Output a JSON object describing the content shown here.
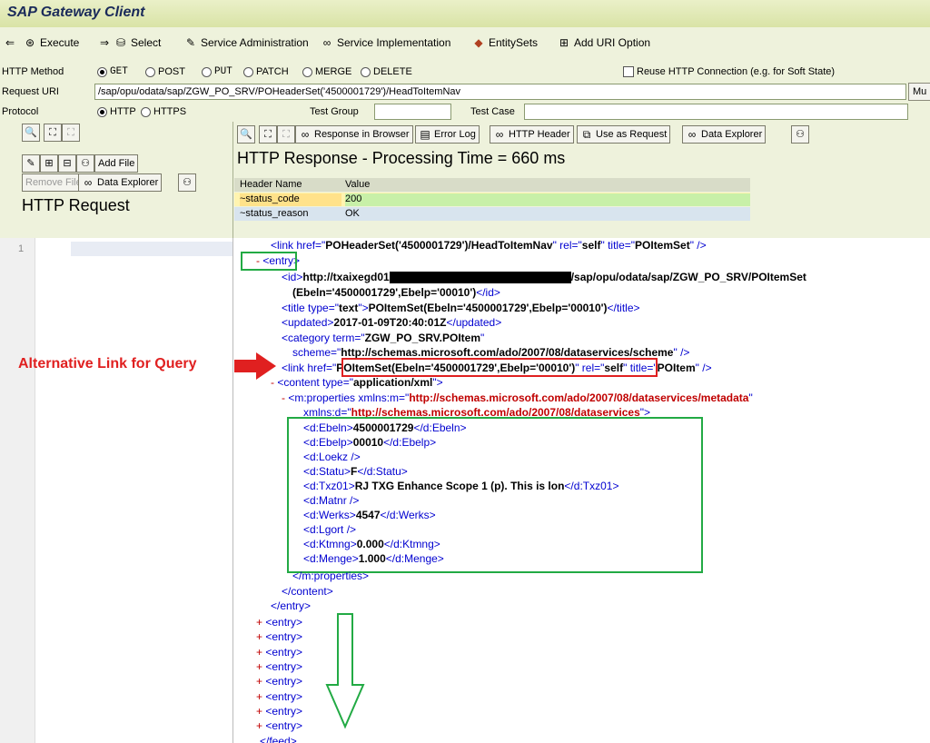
{
  "app": {
    "title": "SAP Gateway Client"
  },
  "toolbar": {
    "execute": "Execute",
    "select": "Select",
    "service_admin": "Service Administration",
    "service_impl": "Service Implementation",
    "entity_sets": "EntitySets",
    "add_uri": "Add URI Option"
  },
  "form": {
    "http_method_label": "HTTP Method",
    "methods": [
      "GET",
      "POST",
      "PUT",
      "PATCH",
      "MERGE",
      "DELETE"
    ],
    "selected_method": "GET",
    "reuse_label": "Reuse HTTP Connection (e.g. for Soft State)",
    "request_uri_label": "Request URI",
    "request_uri": "/sap/opu/odata/sap/ZGW_PO_SRV/POHeaderSet('4500001729')/HeadToItemNav",
    "mu_button": "Mu",
    "protocol_label": "Protocol",
    "protocols": [
      "HTTP",
      "HTTPS"
    ],
    "selected_protocol": "HTTP",
    "test_group_label": "Test Group",
    "test_case_label": "Test Case"
  },
  "request_panel": {
    "add_file": "Add File",
    "remove_file": "Remove File",
    "data_explorer": "Data Explorer",
    "title": "HTTP Request",
    "line_number": "1"
  },
  "response_panel": {
    "response_in_browser": "Response in Browser",
    "error_log": "Error Log",
    "http_header": "HTTP Header",
    "use_as_request": "Use as Request",
    "data_explorer": "Data Explorer",
    "title": "HTTP Response - Processing Time = 660  ms",
    "header_col_name": "Header Name",
    "header_col_value": "Value",
    "headers": [
      {
        "name": "~status_code",
        "value": "200"
      },
      {
        "name": "~status_reason",
        "value": "OK"
      }
    ]
  },
  "annotation": {
    "text": "Alternative Link for Query"
  },
  "xml": {
    "link_self_href": "POHeaderSet('4500001729')/HeadToItemNav",
    "link_self_title": "POItemSet",
    "id_prefix": "http://txaixegd01",
    "id_suffix": "/sap/opu/odata/sap/ZGW_PO_SRV/POItemSet",
    "id_line2": "(Ebeln='4500001729',Ebelp='00010')",
    "title_value": "POItemSet(Ebeln='4500001729',Ebelp='00010')",
    "updated_value": "2017-01-09T20:40:01Z",
    "category_term": "ZGW_PO_SRV.POItem",
    "category_scheme": "http://schemas.microsoft.com/ado/2007/08/dataservices/scheme",
    "link_item_href": "POItemSet(Ebeln='4500001729',Ebelp='00010')",
    "link_item_title": "POItem",
    "content_type": "application/xml",
    "metadata_ns": "http://schemas.microsoft.com/ado/2007/08/dataservices/metadata",
    "dataservices_ns": "http://schemas.microsoft.com/ado/2007/08/dataservices",
    "properties": [
      {
        "tag": "Ebeln",
        "value": "4500001729"
      },
      {
        "tag": "Ebelp",
        "value": "00010"
      },
      {
        "tag": "Loekz",
        "value": ""
      },
      {
        "tag": "Statu",
        "value": "F"
      },
      {
        "tag": "Txz01",
        "value": "RJ TXG Enhance Scope 1 (p). This is lon"
      },
      {
        "tag": "Matnr",
        "value": ""
      },
      {
        "tag": "Werks",
        "value": "4547"
      },
      {
        "tag": "Lgort",
        "value": ""
      },
      {
        "tag": "Ktmng",
        "value": "0.000"
      },
      {
        "tag": "Menge",
        "value": "1.000"
      }
    ],
    "collapsed_entries": 8
  }
}
